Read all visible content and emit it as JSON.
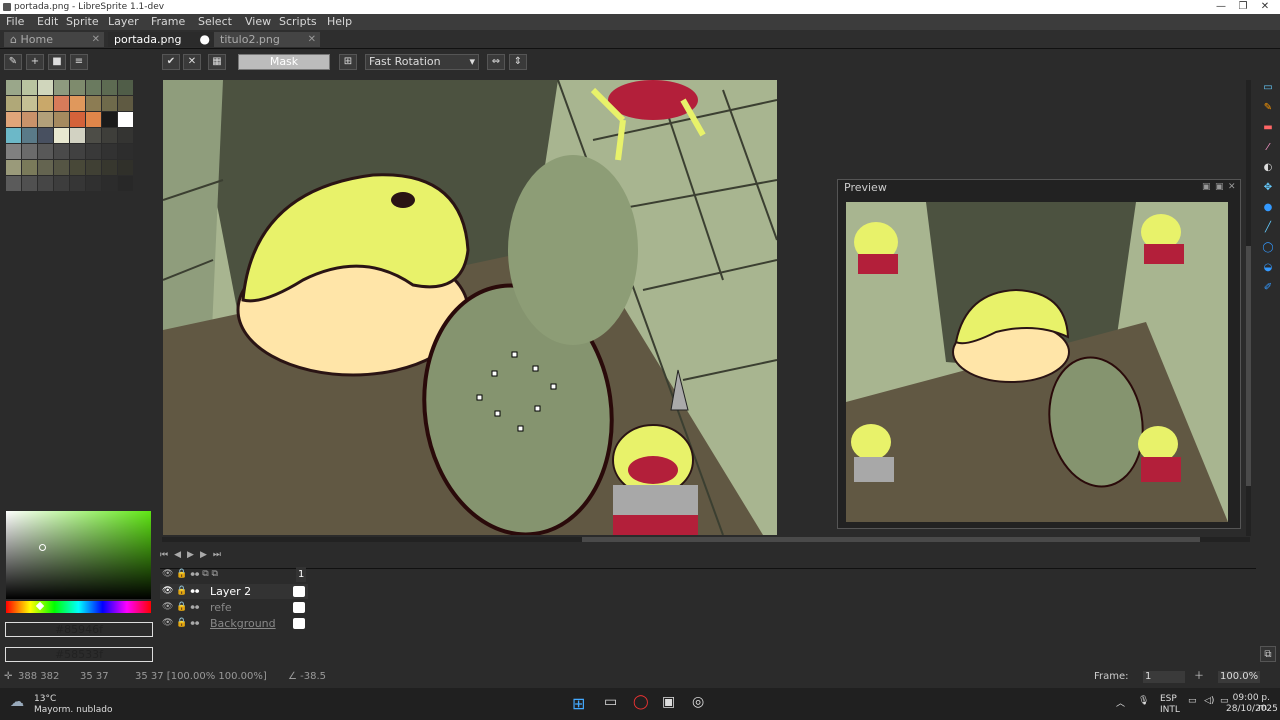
{
  "window": {
    "title": "portada.png - LibreSprite 1.1-dev",
    "buttons": [
      "—",
      "❐",
      "✕"
    ]
  },
  "menu": [
    "File",
    "Edit",
    "Sprite",
    "Layer",
    "Frame",
    "Select",
    "View",
    "Scripts",
    "Help"
  ],
  "tabs": [
    {
      "label": "Home",
      "icon": "⌂"
    },
    {
      "label": "portada.png"
    },
    {
      "label": "titulo2.png"
    }
  ],
  "context_bar": {
    "mask_label": "Mask",
    "rotation_value": "Fast Rotation"
  },
  "palette": {
    "colors": [
      "#9aa78a",
      "#b9c4a0",
      "#d0d6bc",
      "#8e9a7f",
      "#7e8b6d",
      "#6a7a5f",
      "#5d6b52",
      "#505d48",
      "#b0a878",
      "#c5c094",
      "#c9a86a",
      "#d77b5a",
      "#e0985c",
      "#8c7c53",
      "#6f6a4b",
      "#5f5a42",
      "#e0a57a",
      "#c9926a",
      "#b2a07a",
      "#a58a5f",
      "#d4623a",
      "#e0864a",
      "#1a1a1a",
      "#ffffff",
      "#6cb8c8",
      "#5a7a88",
      "#485060",
      "#e8e8d0",
      "#d2d2c2",
      "#4d4d47",
      "#3e3e3a",
      "#343432",
      "#808080",
      "#6b6b6b",
      "#585858",
      "#4a4a4a",
      "#414141",
      "#393939",
      "#323232",
      "#2d2d2d",
      "#9a9a7a",
      "#7a7a5a",
      "#646450",
      "#555544",
      "#484838",
      "#404034",
      "#37372e",
      "#30302a",
      "#5b5b5b",
      "#505050",
      "#464646",
      "#3d3d3d",
      "#363636",
      "#303030",
      "#2c2c2c",
      "#282828"
    ]
  },
  "colors": {
    "foreground": "#85946f",
    "background": "#58533f"
  },
  "preview": {
    "title": "Preview"
  },
  "layers": [
    {
      "name": "Layer 2",
      "selected": true
    },
    {
      "name": "refe"
    },
    {
      "name": "Background"
    }
  ],
  "frame_number_header": "1",
  "status": {
    "coords": "388 382",
    "size": "35   37",
    "selection": "35 37 [100.00% 100.00%]",
    "angle": "∠ -38.5",
    "frame_label": "Frame:",
    "frame_value": "1",
    "zoom": "100.0%"
  },
  "taskbar": {
    "weather_temp": "13°C",
    "weather_desc": "Mayorm. nublado",
    "lang1": "ESP",
    "lang2": "INTL",
    "time": "09:00 p. m.",
    "date": "28/10/2025"
  }
}
